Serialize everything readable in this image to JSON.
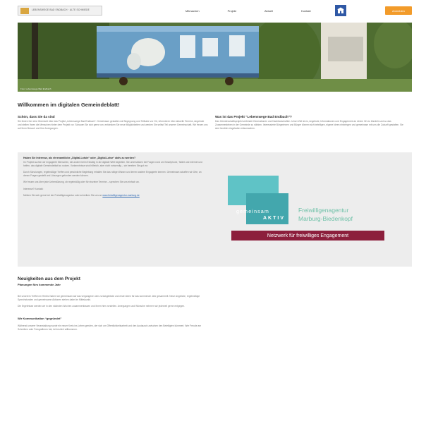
{
  "header": {
    "logo_text": "LEBENSWEGE BAD ENDBACH · ALTE SCHMIEDE",
    "nav": [
      "Mitmachen",
      "Projekt",
      "Aktuell",
      "Kontakt"
    ],
    "cta_label": "Anmelden"
  },
  "colors": {
    "accent": "#f29b2a",
    "nav_icon": "#2f58a5",
    "brand_teal": "#43a7ad",
    "brand_maroon": "#8c1f3c"
  },
  "icons": {
    "nav_icon": "building-icon"
  },
  "hero": {
    "caption": "Foto: Lebenswege Bad Endbach"
  },
  "welcome": {
    "title": "Willkommen im digitalen Gemeindeblatt!",
    "left": {
      "heading": "Schön, dass Sie da sind",
      "text": "Sie finden hier eine Übersicht über das Projekt „Lebenswege Bad Endbach“. Gemeinsam gestalten wir Begegnung und Teilhabe vor Ort, informieren über aktuelle Termine, Angebote und stellen Ihnen die Menschen hinter dem Projekt vor. Schauen Sie sich gerne um, entdecken Sie neue Möglichkeiten und werden Sie selbst Teil unserer Gemeinschaft. Wir freuen uns auf Ihren Besuch und Ihre Anregungen."
    },
    "right": {
      "heading": "Was ist das Projekt “Lebenswege Bad Endbach”?",
      "text": "Das Gemeinschaftsprojekt verbindet Generationen und Nachbarschaften. Unser Ziel ist es, Angebote, Informationen und Engagement an einem Ort zu bündeln und so das Zusammenleben in der Gemeinde zu stärken. Interessierte Bürgerinnen und Bürger können sich beteiligen, eigene Ideen einbringen und gemeinsam mit uns die Zukunft gestalten. Sie sind herzlich eingeladen mitzumachen."
    }
  },
  "callout": {
    "question": "Haben Sie Interesse, als ehrenamtliche „Digital-Lotsin“ oder „Digital-Lotse“ aktiv zu werden?",
    "text1": "Im Projekt suchen wir engagierte Menschen, die andere beim Einstieg in die digitale Welt begleiten. Sie unterstützen bei Fragen rund um Smartphone, Tablet und Internet und helfen, das digitale Gemeindeblatt zu nutzen. Vorkenntnisse sind hilfreich, aber nicht notwendig – wir bereiten Sie gut vor.",
    "text2": "Durch Schulungen, regelmäßige Treffen und persönliche Begleitung erhalten Sie das nötige Wissen und lernen andere Engagierte kennen. Gemeinsam schaffen wir Orte, an denen Fragen gestellt und Lösungen gefunden werden können.",
    "text3": "Wir freuen uns über jede Unterstützung, ob regelmäßig oder für einzelne Termine – sprechen Sie uns einfach an.",
    "contact_label": "Interesse? Kontakt:",
    "contact_text": "Melden Sie sich gerne bei der Freiwilligenagentur oder schreiben Sie uns an",
    "contact_link": "www.freiwilligenagentur-marburg.de"
  },
  "badge": {
    "gemeinsam": "gemeinsam",
    "aktiv": "AKTIV",
    "title_line1": "Freiwilligenagentur",
    "title_line2": "Marburg-Biedenkopf",
    "bar": "Netzwerk für freiwilliges Engagement"
  },
  "news": {
    "title": "Neuigkeiten aus dem Projekt",
    "subtitle": "Planungen fürs kommende Jahr",
    "p1": "Bei unserem Treffen im Herbst haben wir gemeinsam auf das vergangene Jahr zurückgeblickt und erste Ideen für das kommende Jahr gesammelt. Neue Angebote, regelmäßige Sprechstunden und gemeinsame Aktionen stehen dabei im Mittelpunkt.",
    "p2": "Die Ergebnisse werden wir in den nächsten Wochen zusammenfassen und Ihnen hier vorstellen. Anregungen und Wünsche nehmen wir jederzeit gerne entgegen.",
    "head2": "Wir Kommunikation “gegründet”",
    "p3": "Während unserer Veranstaltung wurde ein neuer Kreis ins Leben gerufen, der sich um Öffentlichkeitsarbeit und den Austausch zwischen den Beteiligten kümmert. Wer Freude am Schreiben oder Fotografieren hat, ist herzlich willkommen."
  }
}
